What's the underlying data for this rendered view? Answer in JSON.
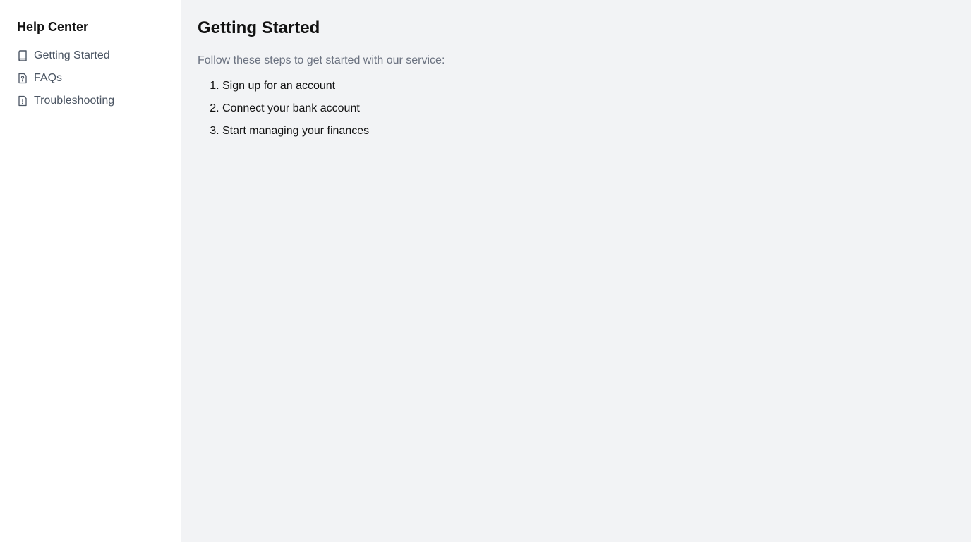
{
  "sidebar": {
    "title": "Help Center",
    "items": [
      {
        "label": "Getting Started",
        "icon": "book-icon"
      },
      {
        "label": "FAQs",
        "icon": "file-question-icon"
      },
      {
        "label": "Troubleshooting",
        "icon": "file-alert-icon"
      }
    ]
  },
  "main": {
    "title": "Getting Started",
    "intro": "Follow these steps to get started with our service:",
    "steps": [
      "Sign up for an account",
      "Connect your bank account",
      "Start managing your finances"
    ]
  },
  "colors": {
    "sidebar_bg": "#ffffff",
    "main_bg": "#f2f3f5",
    "nav_text": "#4b5563",
    "muted_text": "#6b7280",
    "heading_text": "#111111"
  }
}
